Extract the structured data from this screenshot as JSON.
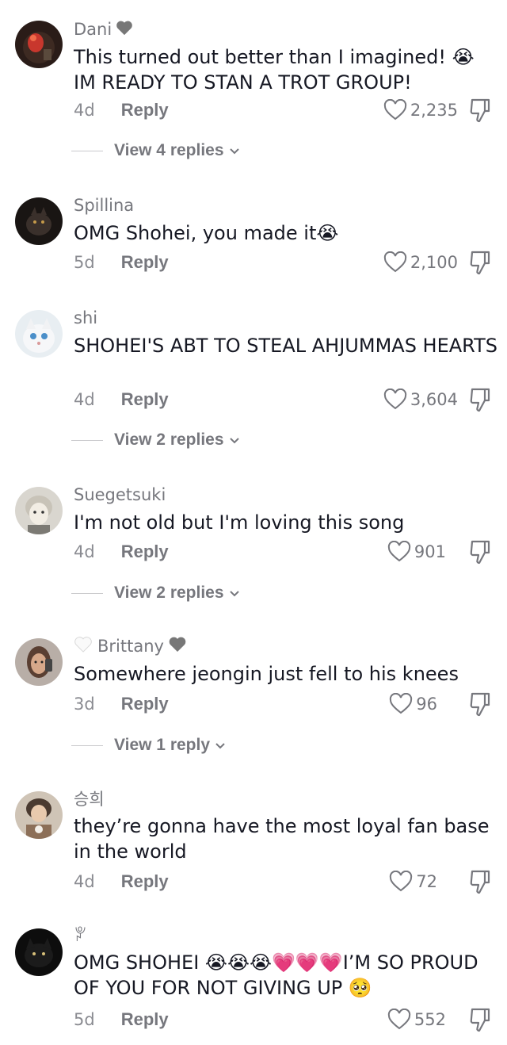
{
  "comments": [
    {
      "username": "Dani",
      "badge_post": "grey-heart",
      "text": "This turned out better than I imagined! 😭 IM READY TO STAN A TROT GROUP!",
      "time": "4d",
      "reply": "Reply",
      "likes": "2,235",
      "view_replies": "View 4 replies"
    },
    {
      "username": "Spillina",
      "text": "OMG Shohei, you made it😭",
      "time": "5d",
      "reply": "Reply",
      "likes": "2,100"
    },
    {
      "username": "shi",
      "text": "SHOHEI'S ABT TO STEAL AHJUMMAS HEARTS",
      "time": "4d",
      "reply": "Reply",
      "likes": "3,604",
      "view_replies": "View 2 replies"
    },
    {
      "username": "Suegetsuki",
      "text": "I'm not old but I'm loving this song",
      "time": "4d",
      "reply": "Reply",
      "likes": "901",
      "view_replies": "View 2 replies"
    },
    {
      "username": "Brittany",
      "badge_pre": "white-heart",
      "badge_post": "grey-heart",
      "text": "Somewhere jeongin just fell to his knees",
      "time": "3d",
      "reply": "Reply",
      "likes": "96",
      "view_replies": "View 1 reply"
    },
    {
      "username": "승희",
      "text": "they’re gonna have the most loyal fan base in the world",
      "time": "4d",
      "reply": "Reply",
      "likes": "72"
    },
    {
      "username": "ꐕ",
      "text": "OMG SHOHEI 😭😭😭💗💗💗I’M SO PROUD OF YOU FOR NOT GIVING UP 🥺",
      "time": "5d",
      "reply": "Reply",
      "likes": "552"
    }
  ],
  "colors": {
    "text": "#161823",
    "meta": "#8a8b91",
    "accent_pink": "#fe2c55"
  }
}
